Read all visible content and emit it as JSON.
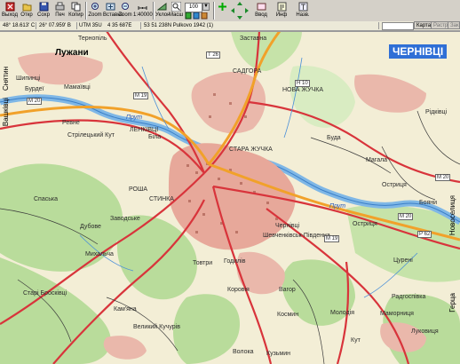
{
  "toolbar": {
    "buttons": [
      {
        "label": "Выход"
      },
      {
        "label": "Откр"
      },
      {
        "label": "Сохр"
      },
      {
        "label": "Печ"
      },
      {
        "label": "Копир"
      },
      {
        "label": "Zoom"
      },
      {
        "label": "Вставка"
      },
      {
        "label": "Zoom"
      },
      {
        "label": "1:40000"
      },
      {
        "label": "Уклон"
      },
      {
        "label": "Масш"
      },
      {
        "label": "Ввод"
      }
    ],
    "zoom_value": "100",
    "right_buttons": [
      {
        "label": "Инф"
      },
      {
        "label": "Назв."
      }
    ]
  },
  "statusbar": {
    "lat": "48° 18.613' С",
    "lon": "26° 07.959' В",
    "utm": "UTM 35U",
    "easting": "4 35 687E",
    "northing": "53 51 238N Pulkovo 1942 (1)",
    "btn_map": "Карта",
    "btn_pattern": "Растр",
    "btn_close": "Закр"
  },
  "map": {
    "city_title": "ЧЕРНІВЦІ",
    "labels": {
      "luzhany": "Лужани",
      "ternopil": "Тернопіль",
      "zastavna": "Заставна",
      "sadhora": "САДГОРА",
      "nova_zhuchka": "НОВА ЖУЧКА",
      "stara_zhuchka": "СТАРА ЖУЧКА",
      "lenkivtsi": "ЛЕНКІВЦІ",
      "ridkivtsi": "Рідківці",
      "buda": "Буда",
      "mahala": "Магала",
      "ostrytsia1": "Остриця",
      "ostrytsia2": "Остриця",
      "prut1": "Прут",
      "prut2": "Прут",
      "boyany": "Бояни",
      "novoselytsia": "Новоселиця",
      "tsureni": "Цурені",
      "radhospivka": "Радгоспівка",
      "mamornytsia": "Мамор­ниця",
      "lukovytsia": "Луковиця",
      "hertsa": "Герца",
      "rosha": "РОША",
      "stynka": "СТИНКА",
      "dubove": "Дубове",
      "zavodske": "Заводське",
      "mykhalcha": "Михальча",
      "spaska": "Спаська",
      "striletskyi_kut": "Стрілецький Кут",
      "bila": "Біла",
      "revne": "Ревне",
      "burdei": "Бурдеї",
      "mamaivtsi": "Мамаївці",
      "shypyntsi": "Шипинці",
      "vashkivtsi": "Вашківці",
      "sniatyn": "Снятин",
      "stari_broskivtsi": "Старі Бросківці",
      "kamiana": "Кам'яна",
      "velykyi_kuchuriv": "Великий Кучурів",
      "korovia": "Коровія",
      "tovtry": "Товтри",
      "hodyliv": "Годилів",
      "zavetsky": "Вагор",
      "kosmyn": "Космин",
      "moloda": "Молодія",
      "volytsia": "Волока",
      "kuzmyn": "Кузьмин",
      "kut": "Кут",
      "pivdenna": "Шевченківськ-Південна",
      "chernivtsi_small": "Чернівці",
      "m19": "М 19",
      "m20a": "М 20",
      "m20b": "М 20",
      "m19b": "М 19",
      "p62": "Р 62",
      "h10": "Н 10",
      "t26": "Т 26",
      "m20c": "М 20"
    }
  }
}
